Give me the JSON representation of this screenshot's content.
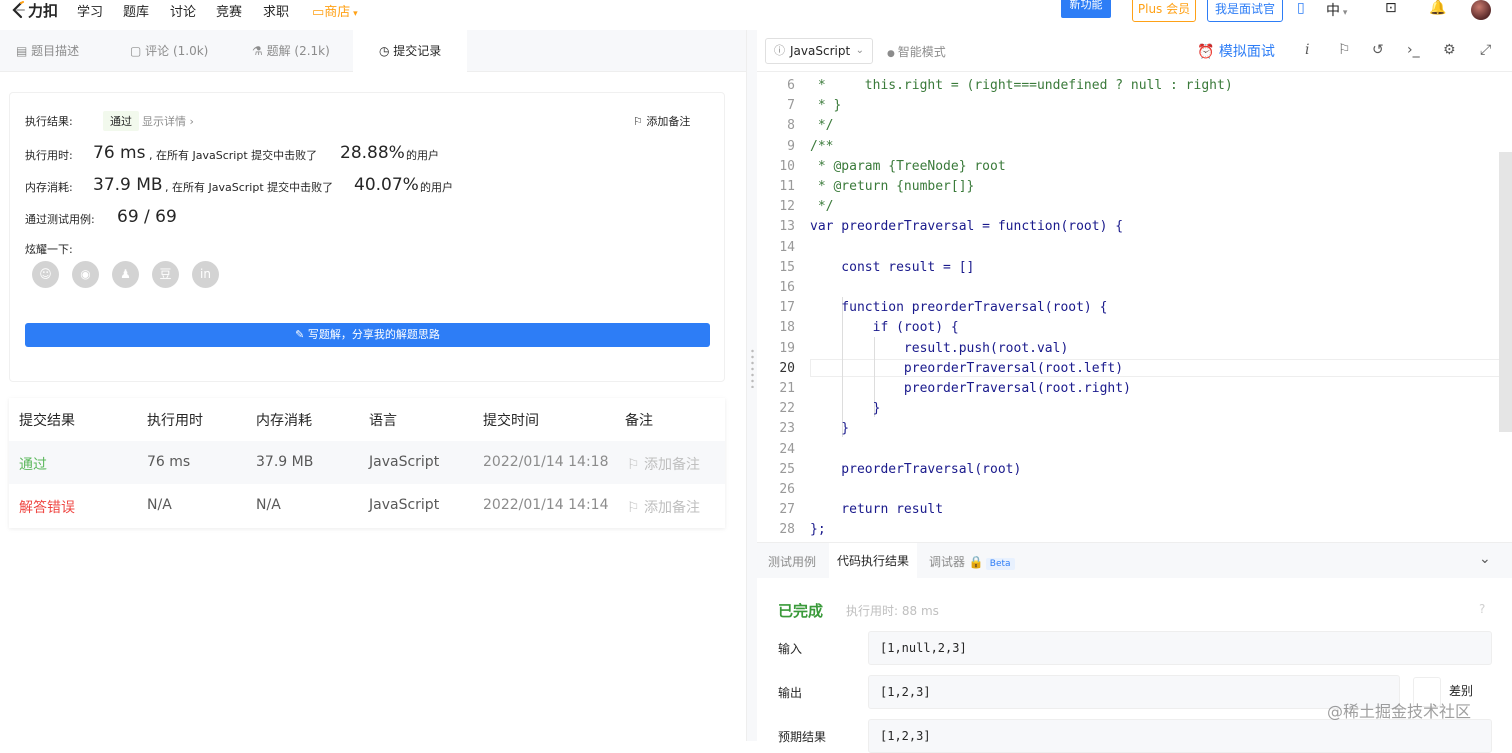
{
  "nav": {
    "logo_text": "力扣",
    "items": [
      "学习",
      "题库",
      "讨论",
      "竞赛",
      "求职"
    ],
    "shop": "商店",
    "new_feature": "新功能",
    "plus": "Plus 会员",
    "interviewer": "我是面试官",
    "lang": "中"
  },
  "left_tabs": {
    "description": "题目描述",
    "comments": "评论 (1.0k)",
    "solutions": "题解 (2.1k)",
    "submissions": "提交记录"
  },
  "result": {
    "exec_result_label": "执行结果:",
    "status": "通过",
    "show_details": "显示详情 ›",
    "add_note": "添加备注",
    "runtime_label": "执行用时:",
    "runtime_value": "76 ms",
    "runtime_beat_text": ", 在所有 JavaScript 提交中击败了",
    "runtime_percent": "28.88%",
    "users_suffix": "的用户",
    "memory_label": "内存消耗:",
    "memory_value": "37.9 MB",
    "memory_beat_text": ", 在所有 JavaScript 提交中击败了",
    "memory_percent": "40.07%",
    "tests_label": "通过测试用例:",
    "tests_value": "69 / 69",
    "share_label": "炫耀一下:",
    "share_icons": [
      "wechat-icon",
      "weibo-icon",
      "qq-icon",
      "douban-icon",
      "linkedin-icon"
    ],
    "share_glyphs": [
      "☺",
      "◉",
      "♟",
      "豆",
      "in"
    ],
    "write_solution": "写题解，分享我的解题思路"
  },
  "table": {
    "headers": [
      "提交结果",
      "执行用时",
      "内存消耗",
      "语言",
      "提交时间",
      "备注"
    ],
    "rows": [
      {
        "result": "通过",
        "time": "76 ms",
        "memory": "37.9 MB",
        "lang": "JavaScript",
        "submitted": "2022/01/14 14:18",
        "note": "添加备注"
      },
      {
        "result": "解答错误",
        "time": "N/A",
        "memory": "N/A",
        "lang": "JavaScript",
        "submitted": "2022/01/14 14:14",
        "note": "添加备注"
      }
    ]
  },
  "editor": {
    "language": "JavaScript",
    "smart_mode": "智能模式",
    "mock_interview": "模拟面试",
    "line_numbers": [
      "6",
      "7",
      "8",
      "9",
      "10",
      "11",
      "12",
      "13",
      "14",
      "15",
      "16",
      "17",
      "18",
      "19",
      "20",
      "21",
      "22",
      "23",
      "24",
      "25",
      "26",
      "27",
      "28"
    ],
    "current_line": "20",
    "code_lines": [
      " *     this.right = (right===undefined ? null : right)",
      " * }",
      " */",
      "/**",
      " * @param {TreeNode} root",
      " * @return {number[]}",
      " */",
      "var preorderTraversal = function(root) {",
      "",
      "    const result = []",
      "",
      "    function preorderTraversal(root) {",
      "        if (root) {",
      "            result.push(root.val)",
      "            preorderTraversal(root.left)",
      "            preorderTraversal(root.right)",
      "        }",
      "    }",
      "",
      "    preorderTraversal(root)",
      "",
      "    return result",
      "};"
    ]
  },
  "bottom": {
    "tabs": [
      "测试用例",
      "代码执行结果",
      "调试器"
    ],
    "beta": "Beta",
    "status": "已完成",
    "exec_time": "执行用时: 88 ms",
    "input_label": "输入",
    "input_value": "[1,null,2,3]",
    "output_label": "输出",
    "output_value": "[1,2,3]",
    "diff": "差别",
    "expected_label": "预期结果",
    "expected_value": "[1,2,3]",
    "watermark": "@稀土掘金技术社区"
  },
  "colors": {
    "accent": "#2d7df6",
    "orange": "#ffa116",
    "success": "#5cb85c",
    "error": "#ef4743"
  }
}
